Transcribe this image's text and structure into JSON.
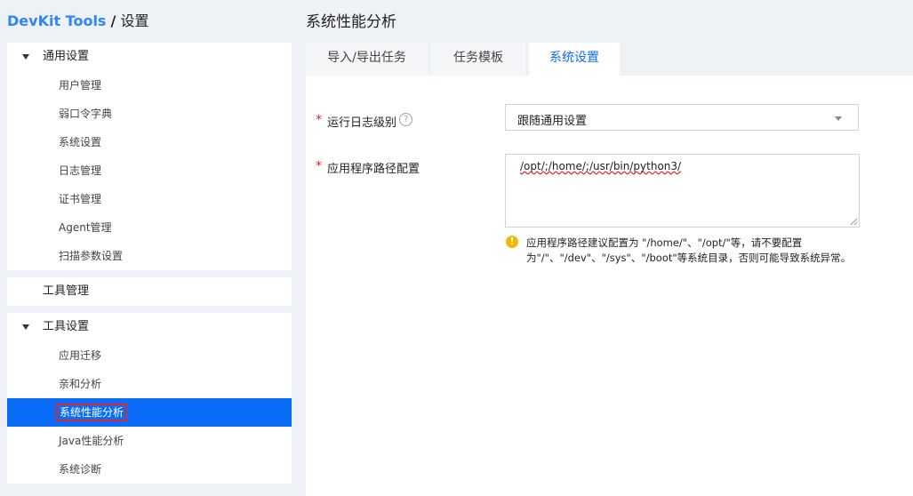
{
  "breadcrumb": {
    "app": "DevKit Tools",
    "separator": "/",
    "current": "设置"
  },
  "page_title": "系统性能分析",
  "sidebar": {
    "general": {
      "label": "通用设置",
      "items": [
        "用户管理",
        "弱口令字典",
        "系统设置",
        "日志管理",
        "证书管理",
        "Agent管理",
        "扫描参数设置"
      ]
    },
    "tool_management": {
      "label": "工具管理"
    },
    "tool_settings": {
      "label": "工具设置",
      "items": [
        "应用迁移",
        "亲和分析",
        "系统性能分析",
        "Java性能分析",
        "系统诊断"
      ],
      "active_index": 2
    }
  },
  "tabs": [
    {
      "label": "导入/导出任务",
      "active": false
    },
    {
      "label": "任务模板",
      "active": false
    },
    {
      "label": "系统设置",
      "active": true
    }
  ],
  "form": {
    "required_mark": "*",
    "log_level": {
      "label": "运行日志级别",
      "help": "?",
      "value": "跟随通用设置"
    },
    "app_path": {
      "label": "应用程序路径配置",
      "value": "/opt/;/home/;/usr/bin/python3/",
      "warning_icon": "!",
      "warning_line1": "应用程序路径建议配置为 \"/home/\"、\"/opt/\"等，请不要配置",
      "warning_line2": "为\"/\"、\"/dev\"、\"/sys\"、\"/boot\"等系统目录，否则可能导致系统异常。"
    }
  },
  "colors": {
    "accent": "#0a6df7",
    "brand": "#2f86f6",
    "required": "#e0252b",
    "warning": "#f5b800"
  }
}
